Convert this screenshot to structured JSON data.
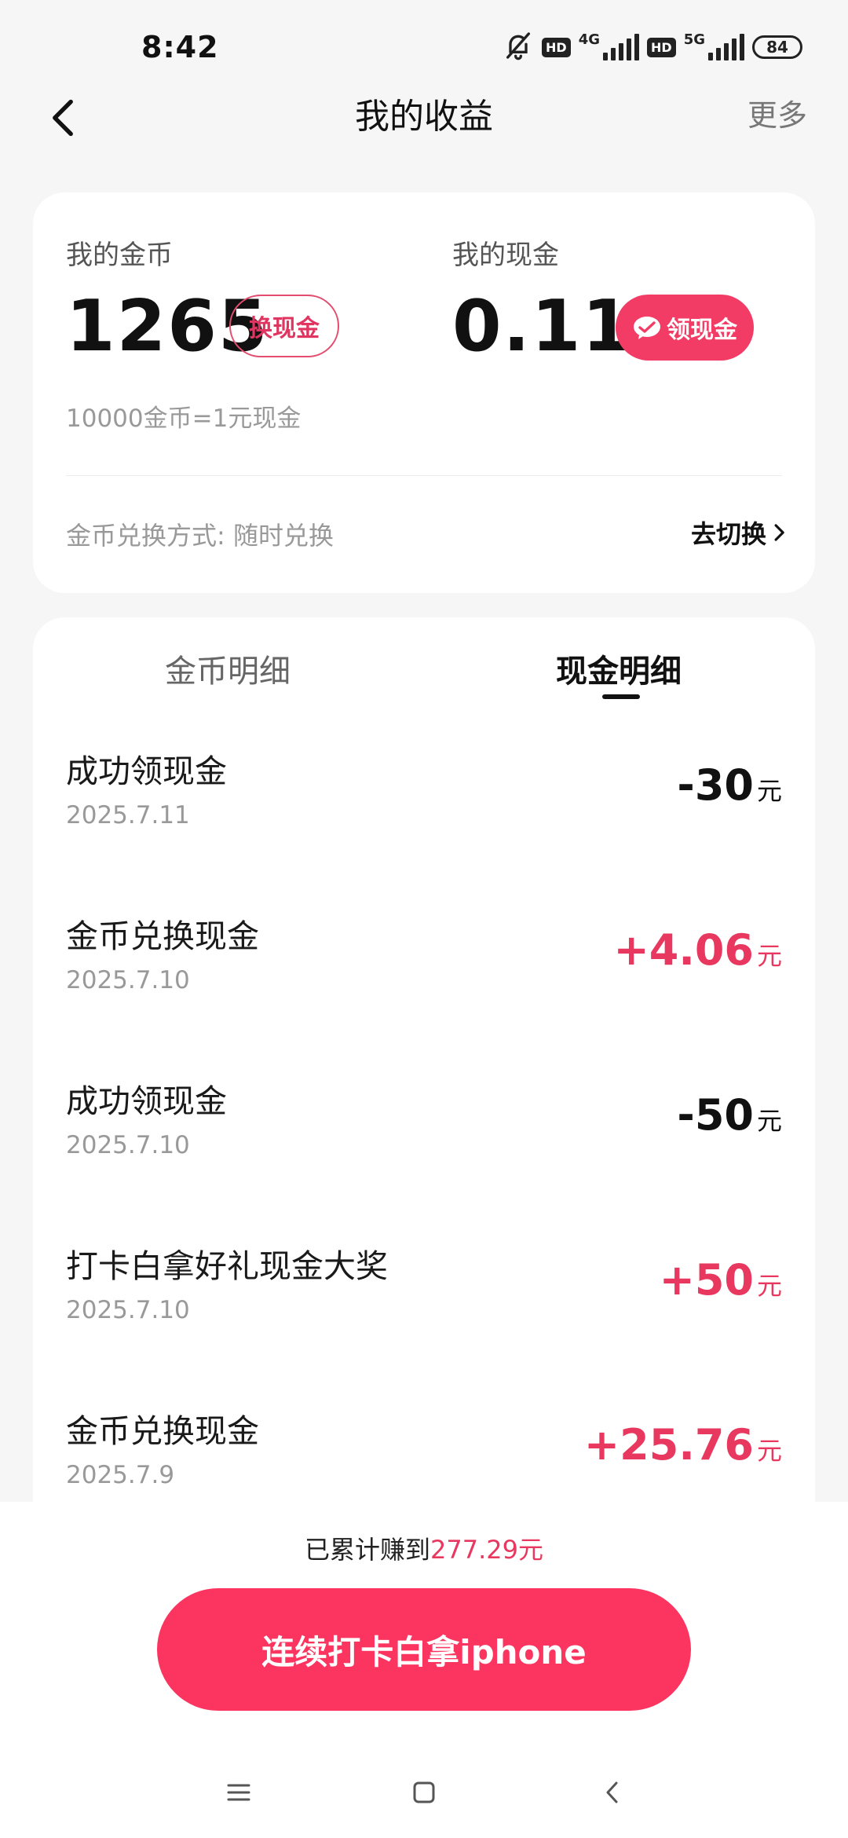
{
  "status_bar": {
    "time": "8:42",
    "hd_label": "HD",
    "net_1": "4G",
    "net_2": "5G",
    "battery": "84"
  },
  "header": {
    "title": "我的收益",
    "more_label": "更多"
  },
  "summary": {
    "coin_label": "我的金币",
    "coin_value": "1265",
    "exchange_button": "换现金",
    "cash_label": "我的现金",
    "cash_value": "0.11",
    "claim_button": "领现金",
    "rate_text": "10000金币=1元现金",
    "method_text": "金币兑换方式: 随时兑换",
    "switch_label": "去切换"
  },
  "tabs": {
    "coin_tab": "金币明细",
    "cash_tab": "现金明细"
  },
  "transactions": [
    {
      "title": "成功领现金",
      "date": "2025.7.11",
      "amount": "-30",
      "unit": "元"
    },
    {
      "title": "金币兑换现金",
      "date": "2025.7.10",
      "amount": "+4.06",
      "unit": "元"
    },
    {
      "title": "成功领现金",
      "date": "2025.7.10",
      "amount": "-50",
      "unit": "元"
    },
    {
      "title": "打卡白拿好礼现金大奖",
      "date": "2025.7.10",
      "amount": "+50",
      "unit": "元"
    },
    {
      "title": "金币兑换现金",
      "date": "2025.7.9",
      "amount": "+25.76",
      "unit": "元"
    }
  ],
  "bottom": {
    "total_prefix": "已累计赚到",
    "total_amount": "277.29元",
    "cta_label": "连续打卡白拿iphone"
  },
  "colors": {
    "accent": "#f23c66",
    "positive": "#e8385f",
    "background": "#f6f6f6"
  }
}
